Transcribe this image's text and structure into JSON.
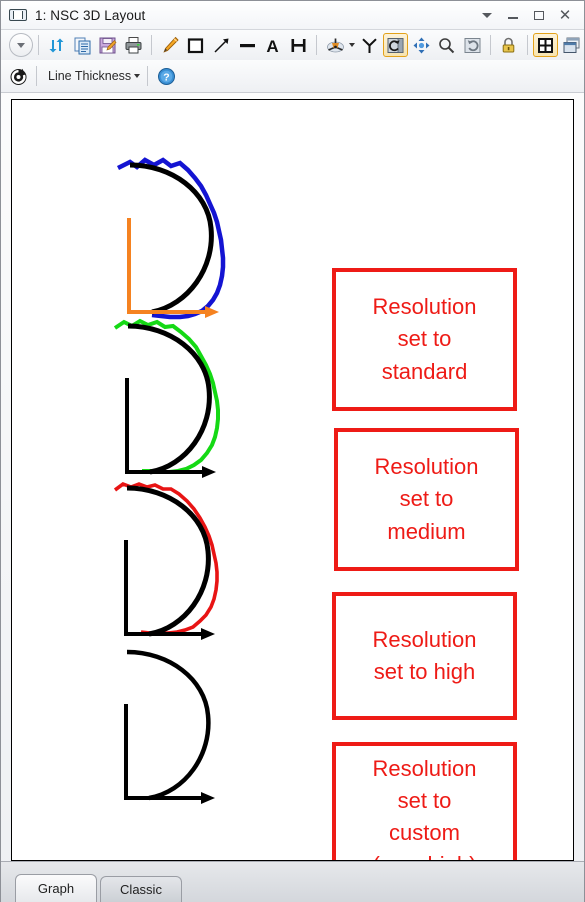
{
  "window": {
    "title": "1: NSC 3D Layout",
    "icon": "layout-window-icon",
    "controls": [
      {
        "name": "dropdown-menu-button",
        "glyph": "▾",
        "label": "Menu"
      },
      {
        "name": "minimize-button",
        "glyph": "–",
        "label": "Minimize"
      },
      {
        "name": "maximize-button",
        "glyph": "□",
        "label": "Maximize"
      },
      {
        "name": "close-button",
        "glyph": "✕",
        "label": "Close"
      }
    ]
  },
  "toolbar_row1": [
    {
      "name": "settings-expander-button",
      "icon": "chevron-down-circle-icon",
      "label": "Settings"
    },
    {
      "sep": true
    },
    {
      "name": "update-button",
      "icon": "refresh-arrows-icon",
      "label": "Update"
    },
    {
      "name": "copy-button",
      "icon": "copy-clipboard-icon",
      "label": "Copy"
    },
    {
      "name": "save-button",
      "icon": "save-disk-pencil-icon",
      "label": "Save"
    },
    {
      "name": "print-button",
      "icon": "printer-icon",
      "label": "Print"
    },
    {
      "sep": true
    },
    {
      "name": "annotate-pencil-button",
      "icon": "pencil-icon",
      "label": "Annotate"
    },
    {
      "name": "rectangle-button",
      "icon": "square-outline-icon",
      "label": "Rectangle"
    },
    {
      "name": "arrow-button",
      "icon": "diagonal-arrow-icon",
      "label": "Arrow"
    },
    {
      "name": "line-button",
      "icon": "horizontal-line-icon",
      "label": "Line"
    },
    {
      "name": "text-button",
      "icon": "letter-a-icon",
      "label": "Text"
    },
    {
      "name": "dimension-button",
      "icon": "h-dimension-icon",
      "label": "Dimension"
    },
    {
      "sep": true
    },
    {
      "name": "orientation-button",
      "icon": "3d-axes-tripod-icon",
      "label": "Orientation"
    },
    {
      "name": "orientation-dropdown",
      "icon": "chevron-down-icon",
      "label": "Orientation options"
    },
    {
      "name": "rotate-view-button",
      "icon": "y-tripod-icon",
      "label": "Rotate view"
    },
    {
      "name": "rotate-tool-button",
      "icon": "rotate-box-icon",
      "label": "Rotate",
      "active": true
    },
    {
      "name": "pan-button",
      "icon": "four-way-move-icon",
      "label": "Pan"
    },
    {
      "name": "zoom-button",
      "icon": "magnifier-icon",
      "label": "Zoom"
    },
    {
      "name": "reset-view-button",
      "icon": "reset-rotate-icon",
      "label": "Reset view"
    },
    {
      "sep": true
    },
    {
      "name": "lock-button",
      "icon": "padlock-icon",
      "label": "Lock"
    },
    {
      "sep": true
    },
    {
      "name": "fit-window-button",
      "icon": "fit-to-window-icon",
      "label": "Fit window",
      "active": true
    },
    {
      "name": "detach-window-button",
      "icon": "detach-window-icon",
      "label": "Detach"
    }
  ],
  "toolbar_row2": [
    {
      "name": "reset-button",
      "icon": "reset-circle-icon",
      "label": "Reset"
    },
    {
      "sep": true
    },
    {
      "name": "line-thickness-dropdown",
      "icon": "chevron-down-icon",
      "label": "Line Thickness"
    },
    {
      "sep": true
    },
    {
      "name": "help-button",
      "icon": "question-help-icon",
      "label": "Help"
    }
  ],
  "toolbar_row2_label": "Line Thickness",
  "canvas": {
    "notes": [
      {
        "name": "note-standard",
        "lines": [
          "Resolution",
          "set to",
          "standard"
        ]
      },
      {
        "name": "note-medium",
        "lines": [
          "Resolution",
          "set to",
          "medium"
        ]
      },
      {
        "name": "note-high",
        "lines": [
          "Resolution",
          "set to high"
        ]
      },
      {
        "name": "note-custom",
        "lines": [
          "Resolution",
          "set to",
          "custom",
          "(very high)"
        ]
      }
    ],
    "plots": [
      {
        "name": "plot-standard",
        "ray_color": "#1414d2",
        "axis_color": "#f58220",
        "jitter": 5.2,
        "segments": 26
      },
      {
        "name": "plot-medium",
        "ray_color": "#15d915",
        "axis_color": "#000000",
        "jitter": 3.6,
        "segments": 38
      },
      {
        "name": "plot-high",
        "ray_color": "#e81414",
        "axis_color": "#000000",
        "jitter": 2.2,
        "segments": 54
      },
      {
        "name": "plot-custom",
        "ray_color": "#000000",
        "axis_color": "#000000",
        "jitter": 0.0,
        "segments": 120
      }
    ]
  },
  "colors": {
    "note_border": "#ee1b16",
    "note_text": "#ee1b16",
    "accent_active": "#e3a21a",
    "curve_black": "#000000"
  },
  "tabs": [
    {
      "name": "tab-graph",
      "label": "Graph",
      "selected": true
    },
    {
      "name": "tab-classic",
      "label": "Classic",
      "selected": false
    }
  ]
}
